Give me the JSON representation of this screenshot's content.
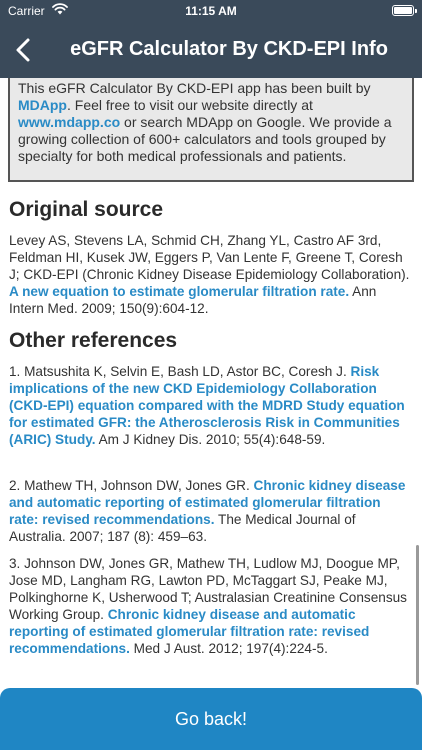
{
  "status": {
    "carrier": "Carrier",
    "time": "11:15 AM"
  },
  "nav": {
    "title": "eGFR Calculator By CKD-EPI Info"
  },
  "info": {
    "t1": "This eGFR Calculator By CKD-EPI app has been built by",
    "link1": "MDApp",
    "t2": ". Feel free to visit our website directly at",
    "link2": "www.mdapp.co",
    "t3": " or search MDApp on Google. We provide a growing collection of 600+ calculators and tools grouped by specialty for both medical professionals and patients."
  },
  "original": {
    "heading": "Original source",
    "text": "Levey AS, Stevens LA, Schmid CH, Zhang YL, Castro AF 3rd, Feldman HI, Kusek JW, Eggers P, Van Lente F, Greene T, Coresh J; CKD-EPI (Chronic Kidney Disease Epidemiology Collaboration). ",
    "link": "A new equation to estimate glomerular filtration rate.",
    "tail": "  Ann Intern Med. 2009; 150(9):604-12."
  },
  "other": {
    "heading": "Other references",
    "refs": [
      {
        "text": "1. Matsushita K, Selvin E, Bash LD, Astor BC, Coresh J. ",
        "link": "Risk implications of the new CKD Epidemiology Collaboration (CKD-EPI) equation compared with the MDRD Study equation for estimated GFR: the Atherosclerosis Risk in Communities (ARIC) Study.",
        "tail": "  Am J Kidney Dis. 2010; 55(4):648-59."
      },
      {
        "text": "2. Mathew TH, Johnson DW, Jones GR. ",
        "link": "Chronic kidney disease and automatic reporting of estimated glomerular filtration rate: revised recommendations.",
        "tail": "  The Medical Journal of Australia. 2007; 187 (8): 459–63."
      },
      {
        "text": "3. Johnson DW, Jones GR, Mathew TH, Ludlow MJ, Doogue MP, Jose MD, Langham RG, Lawton PD, McTaggart SJ, Peake MJ, Polkinghorne K, Usherwood T; Australasian Creatinine Consensus Working Group. ",
        "link": "Chronic kidney disease and automatic reporting of estimated glomerular filtration rate: revised recommendations.",
        "tail": "  Med J Aust. 2012; 197(4):224-5."
      }
    ]
  },
  "footer": {
    "button": "Go back!"
  }
}
